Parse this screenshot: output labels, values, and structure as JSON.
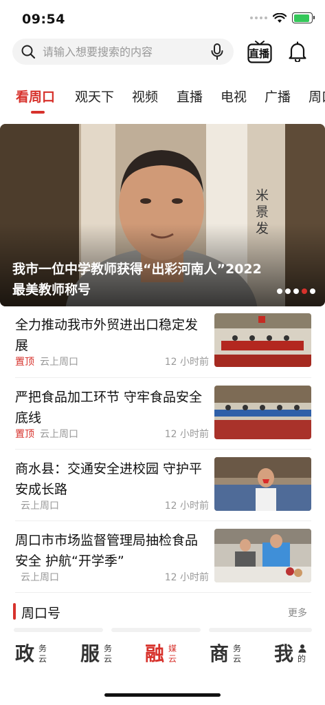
{
  "status_bar": {
    "time": "09:54",
    "battery_level": 0.9
  },
  "search": {
    "placeholder": "请输入想要搜索的内容",
    "mic_icon": "microphone-icon",
    "search_icon": "search-icon"
  },
  "header": {
    "live_label": "直播",
    "live_icon": "tv-icon",
    "bell_icon": "bell-icon"
  },
  "tabs": [
    {
      "label": "看周口",
      "active": true
    },
    {
      "label": "观天下"
    },
    {
      "label": "视频"
    },
    {
      "label": "直播"
    },
    {
      "label": "电视"
    },
    {
      "label": "广播"
    },
    {
      "label": "周口"
    }
  ],
  "banner": {
    "title": "我市一位中学教师获得“出彩河南人”2022最美教师称号",
    "photo_text": "米景发",
    "slide_count": 4,
    "active_slide": 3
  },
  "news": [
    {
      "title": "全力推动我市外贸进出口稳定发展",
      "pinned_label": "置顶",
      "source": "云上周口",
      "time": "12 小时前"
    },
    {
      "title": "严把食品加工环节 守牢食品安全底线",
      "pinned_label": "置顶",
      "source": "云上周口",
      "time": "12 小时前"
    },
    {
      "title": "商水县：交通安全进校园 守护平安成长路",
      "pinned_label": "",
      "source": "云上周口",
      "time": "12 小时前"
    },
    {
      "title": "周口市市场监督管理局抽检食品安全 护航“开学季”",
      "pinned_label": "",
      "source": "云上周口",
      "time": "12 小时前"
    }
  ],
  "section": {
    "title": "周口号",
    "more": "更多"
  },
  "bottom_nav": [
    {
      "big": "政",
      "small": "务云",
      "active": false
    },
    {
      "big": "服",
      "small": "务云",
      "active": false
    },
    {
      "big": "融",
      "small": "媒云",
      "active": true
    },
    {
      "big": "商",
      "small": "务云",
      "active": false
    },
    {
      "big": "我",
      "small": "的",
      "active": false,
      "icon": "person-icon"
    }
  ],
  "colors": {
    "accent": "#d7322c",
    "battery": "#34c759"
  }
}
